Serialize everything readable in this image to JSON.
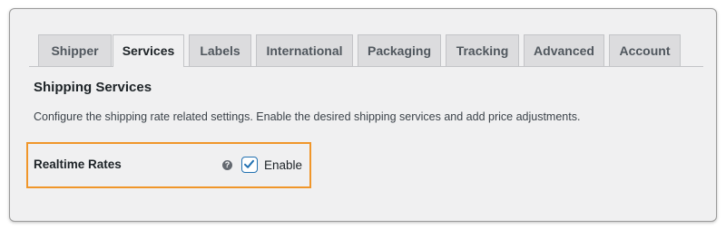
{
  "tabs": [
    {
      "label": "Shipper",
      "active": false
    },
    {
      "label": "Services",
      "active": true
    },
    {
      "label": "Labels",
      "active": false
    },
    {
      "label": "International",
      "active": false
    },
    {
      "label": "Packaging",
      "active": false
    },
    {
      "label": "Tracking",
      "active": false
    },
    {
      "label": "Advanced",
      "active": false
    },
    {
      "label": "Account",
      "active": false
    }
  ],
  "section": {
    "title": "Shipping Services",
    "description": "Configure the shipping rate related settings. Enable the desired shipping services and add price adjustments."
  },
  "realtime_rates": {
    "label": "Realtime Rates",
    "help_icon": "question-circle-icon",
    "help_glyph": "?",
    "checkbox_checked": true,
    "checkbox_label": "Enable"
  },
  "colors": {
    "highlight_border": "#f0962a",
    "checkbox_accent": "#2271b1",
    "panel_background": "#f0f0f1"
  }
}
